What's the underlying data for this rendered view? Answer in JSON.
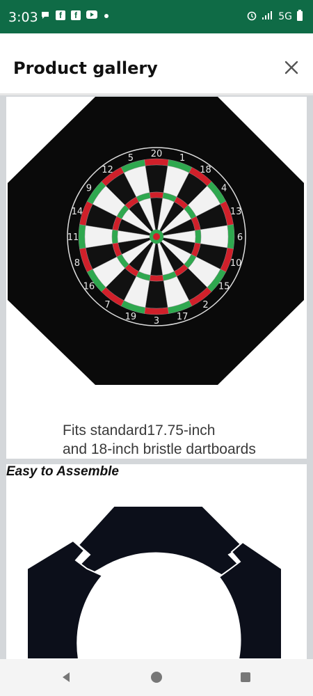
{
  "status_bar": {
    "time": "3:03",
    "network": "5G"
  },
  "header": {
    "title": "Product gallery"
  },
  "gallery": {
    "images": [
      {
        "caption_line1": "Fits standard17.75-inch",
        "caption_line2": "and 18-inch bristle dartboards"
      },
      {
        "title": "Easy to Assemble"
      }
    ]
  },
  "dartboard": {
    "numbers": [
      "20",
      "1",
      "18",
      "4",
      "13",
      "6",
      "10",
      "15",
      "2",
      "17",
      "3",
      "19",
      "7",
      "16",
      "8",
      "11",
      "14",
      "9",
      "12",
      "5"
    ]
  },
  "icons": {
    "close": "close-icon",
    "back": "back-icon",
    "home": "home-icon",
    "recents": "recents-icon"
  }
}
